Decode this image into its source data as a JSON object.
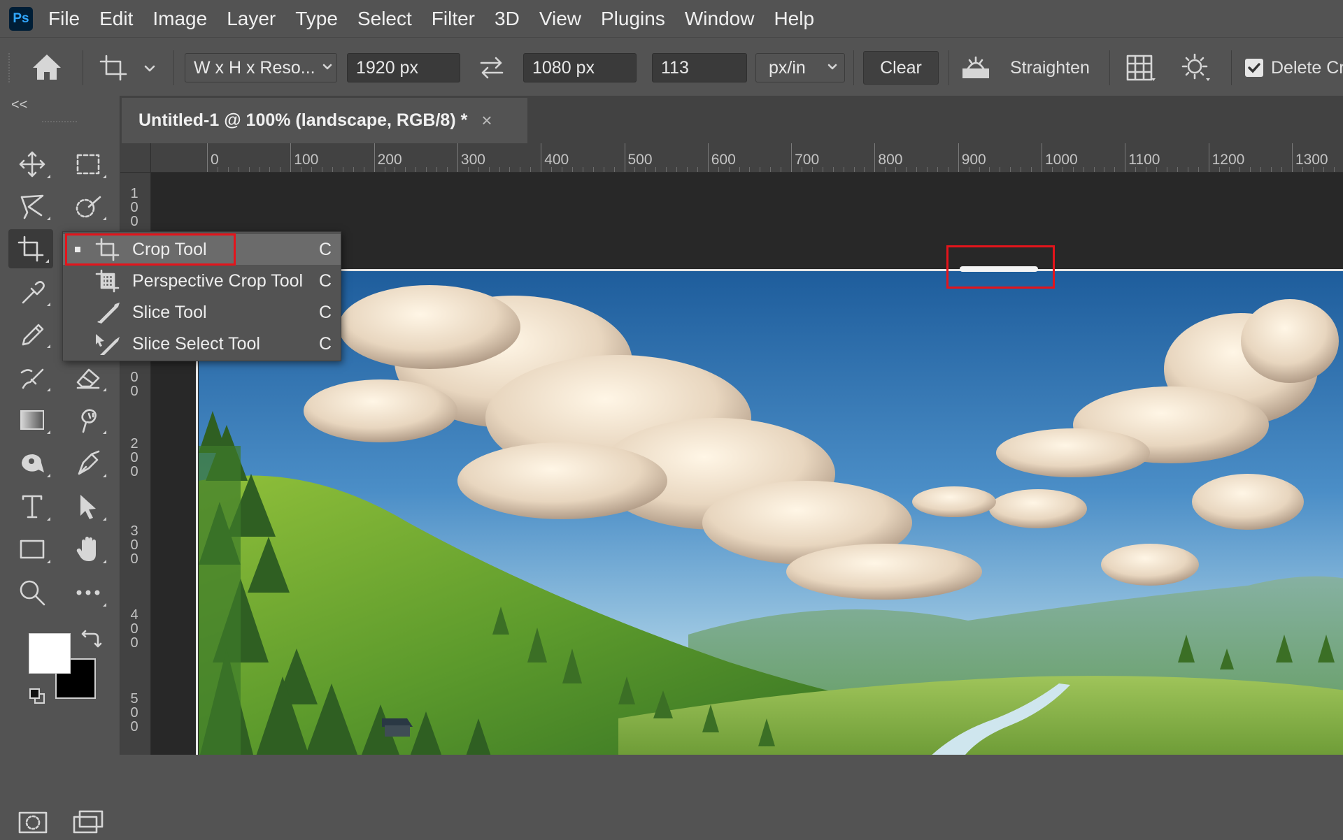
{
  "app": {
    "logo": "Ps"
  },
  "menu": [
    "File",
    "Edit",
    "Image",
    "Layer",
    "Type",
    "Select",
    "Filter",
    "3D",
    "View",
    "Plugins",
    "Window",
    "Help"
  ],
  "options": {
    "ratio_preset": "W x H x Reso...",
    "width": "1920 px",
    "height": "1080 px",
    "resolution": "113",
    "resolution_unit": "px/in",
    "clear_label": "Clear",
    "straighten_label": "Straighten",
    "delete_cropped_label": "Delete Cr",
    "delete_cropped_checked": true
  },
  "toolbar": {
    "collapse_glyph": "<<"
  },
  "document": {
    "tab_title": "Untitled-1 @ 100% (landscape, RGB/8) *",
    "close_glyph": "×"
  },
  "ruler": {
    "h_labels": [
      "0",
      "100",
      "200",
      "300",
      "400",
      "500",
      "600",
      "700",
      "800",
      "900",
      "1000",
      "1100",
      "1200",
      "1300"
    ],
    "v_labels": [
      "1\n0\n0",
      "0\n0",
      "2\n0\n0",
      "3\n0\n0",
      "4\n0\n0",
      "5\n0\n0"
    ]
  },
  "flyout": {
    "items": [
      {
        "label": "Crop Tool",
        "key": "C",
        "icon": "crop-icon",
        "selected": true
      },
      {
        "label": "Perspective Crop Tool",
        "key": "C",
        "icon": "perspective-crop-icon",
        "selected": false
      },
      {
        "label": "Slice Tool",
        "key": "C",
        "icon": "slice-icon",
        "selected": false
      },
      {
        "label": "Slice Select Tool",
        "key": "C",
        "icon": "slice-select-icon",
        "selected": false
      }
    ]
  },
  "colors": {
    "foreground": "#ffffff",
    "background": "#000000",
    "highlight": "#e4141b"
  }
}
